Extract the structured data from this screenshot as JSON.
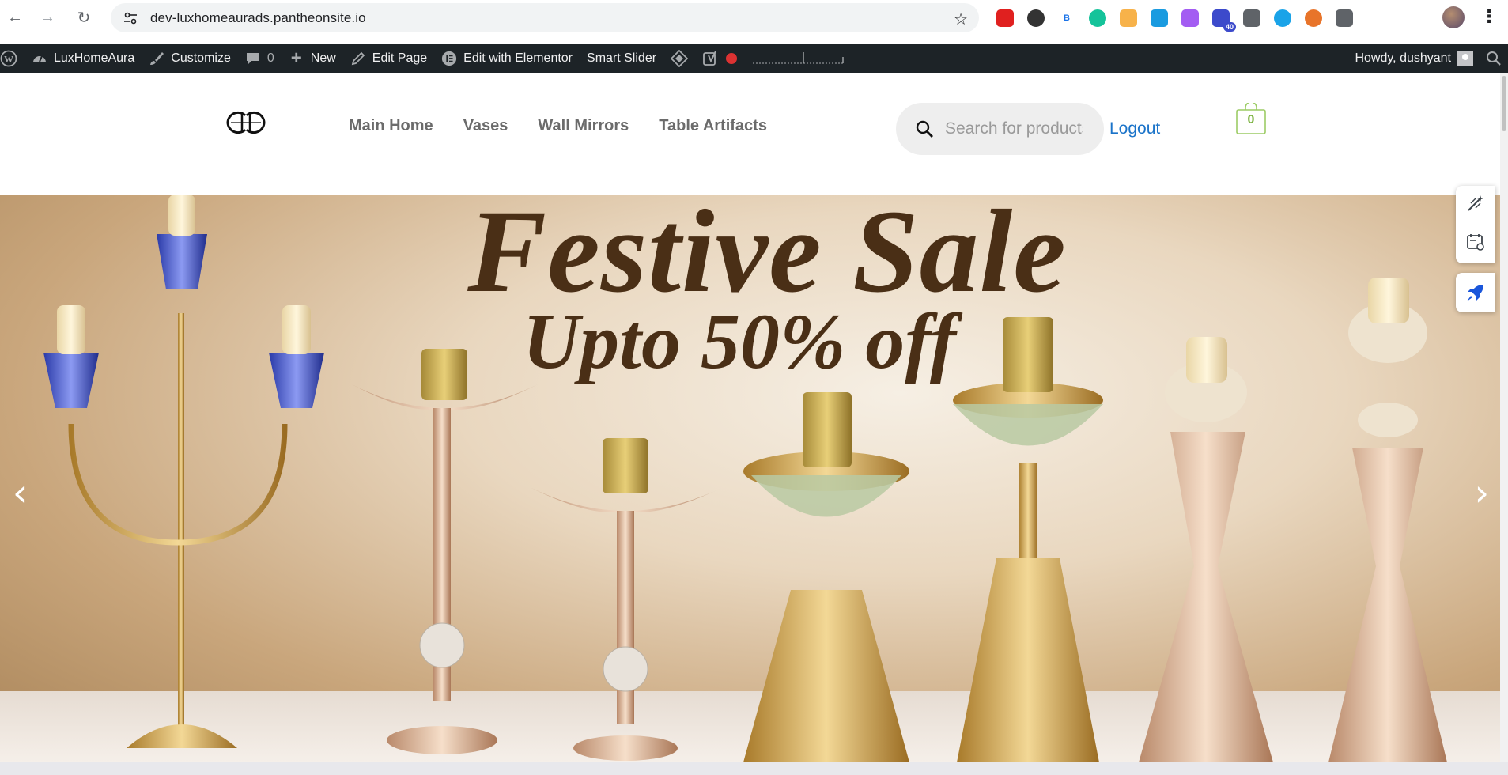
{
  "browser": {
    "url": "dev-luxhomeaurads.pantheonsite.io",
    "extensions": [
      {
        "icon": "opera-icon",
        "color": "#e0201f",
        "label": ""
      },
      {
        "icon": "circles-icon",
        "color": "#333333",
        "label": ""
      },
      {
        "icon": "b-icon",
        "color": "#ffffff",
        "label": "B"
      },
      {
        "icon": "grammarly-icon",
        "color": "#15c39a",
        "label": ""
      },
      {
        "icon": "target-icon",
        "color": "#f7b24a",
        "label": ""
      },
      {
        "icon": "cap-icon",
        "color": "#1a9be0",
        "label": ""
      },
      {
        "icon": "brush-icon",
        "color": "#a35cf2",
        "label": ""
      },
      {
        "icon": "school-icon",
        "color": "#3c4acb",
        "label": "",
        "badge": "40"
      },
      {
        "icon": "tabs-icon",
        "color": "#5f6368",
        "label": ""
      },
      {
        "icon": "download-icon",
        "color": "#1aa3e8",
        "label": ""
      },
      {
        "icon": "fox-icon",
        "color": "#e8742a",
        "label": ""
      },
      {
        "icon": "puzzle-icon",
        "color": "#5f6368",
        "label": ""
      }
    ]
  },
  "adminbar": {
    "site_name": "LuxHomeAura",
    "customize": "Customize",
    "comments_count": "0",
    "new_label": "New",
    "edit_page": "Edit Page",
    "elementor": "Edit with Elementor",
    "smart_slider": "Smart Slider",
    "howdy": "Howdy, dushyant"
  },
  "header": {
    "nav": [
      "Main Home",
      "Vases",
      "Wall Mirrors",
      "Table Artifacts"
    ],
    "search_placeholder": "Search for products",
    "logout": "Logout",
    "cart_count": "0"
  },
  "hero": {
    "title": "Festive Sale",
    "subtitle": "Upto 50% off",
    "prev_arrow": "‹",
    "next_arrow": "›"
  },
  "colors": {
    "adminbar_bg": "#1d2327",
    "link_blue": "#1a73c9",
    "cart_green": "#7cb342",
    "hero_text": "#4a2f16"
  }
}
